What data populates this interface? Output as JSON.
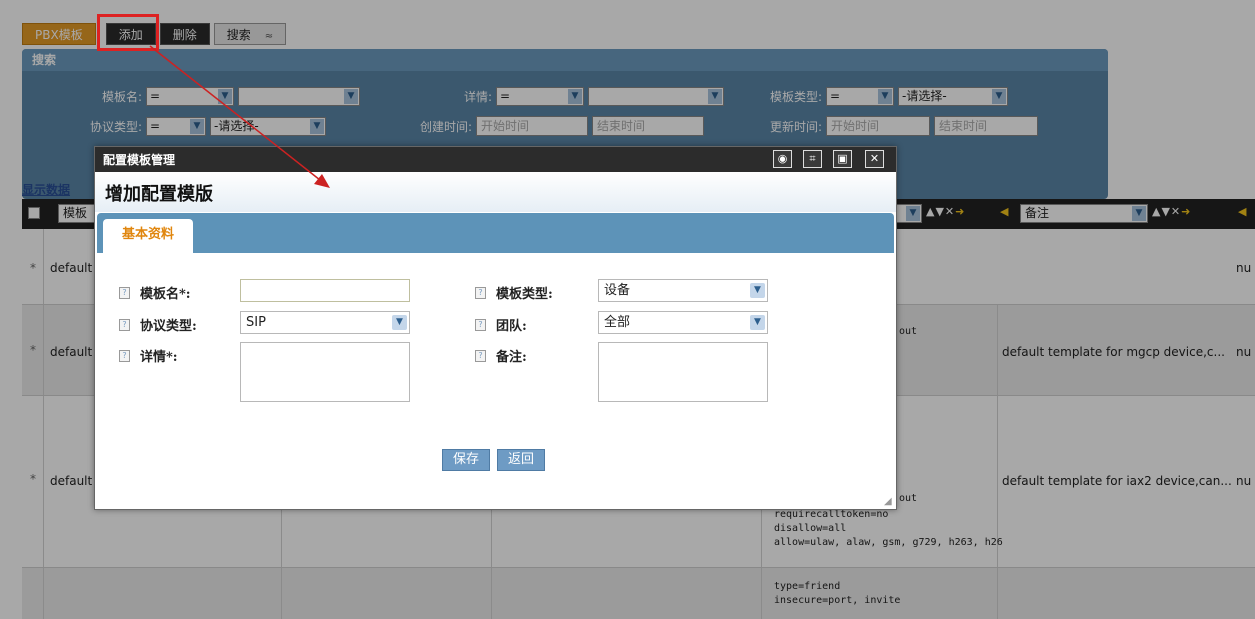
{
  "toolbar": {
    "tab_label": "PBX模板",
    "add_label": "添加",
    "delete_label": "删除",
    "search_label": "搜索",
    "search_toggle": "≈"
  },
  "search": {
    "title": "搜索",
    "template_name_label": "模板名:",
    "template_name_op": "=",
    "detail_label": "详情:",
    "detail_op": "=",
    "template_type_label": "模板类型:",
    "template_type_op": "=",
    "template_type_value": "-请选择-",
    "protocol_label": "协议类型:",
    "protocol_op": "=",
    "protocol_value": "-请选择-",
    "created_label": "创建时间:",
    "created_start": "开始时间",
    "created_end": "结束时间",
    "updated_label": "更新时间:",
    "updated_start": "开始时间",
    "updated_end": "结束时间"
  },
  "show_data_label": "显示数据",
  "grid": {
    "col_template_name": "模板",
    "col_remark": "备注",
    "rows": [
      {
        "name": "default",
        "right": "nu"
      },
      {
        "name": "default",
        "config_tail": "out",
        "remark": "default template for mgcp device,c...",
        "right": "nu"
      },
      {
        "name": "default",
        "config_tail": "out",
        "config": "requirecalltoken=no\ndisallow=all\nallow=ulaw, alaw, gsm, g729, h263, h26",
        "remark": "default template for iax2 device,can...",
        "right": "nu"
      },
      {
        "config": "type=friend\ninsecure=port, invite"
      }
    ]
  },
  "dialog": {
    "window_title": "配置模板管理",
    "heading": "增加配置模版",
    "tab_basic": "基本资料",
    "template_name_label": "模板名*:",
    "template_type_label": "模板类型:",
    "template_type_value": "设备",
    "protocol_label": "协议类型:",
    "protocol_value": "SIP",
    "team_label": "团队:",
    "team_value": "全部",
    "detail_label": "详情*:",
    "remark_label": "备注:",
    "save_label": "保存",
    "back_label": "返回"
  },
  "colors": {
    "search_panel": "#5a86a8",
    "tab_bar": "#5d93b8",
    "accent_orange": "#e49b26",
    "highlight_red": "#dd2222"
  }
}
